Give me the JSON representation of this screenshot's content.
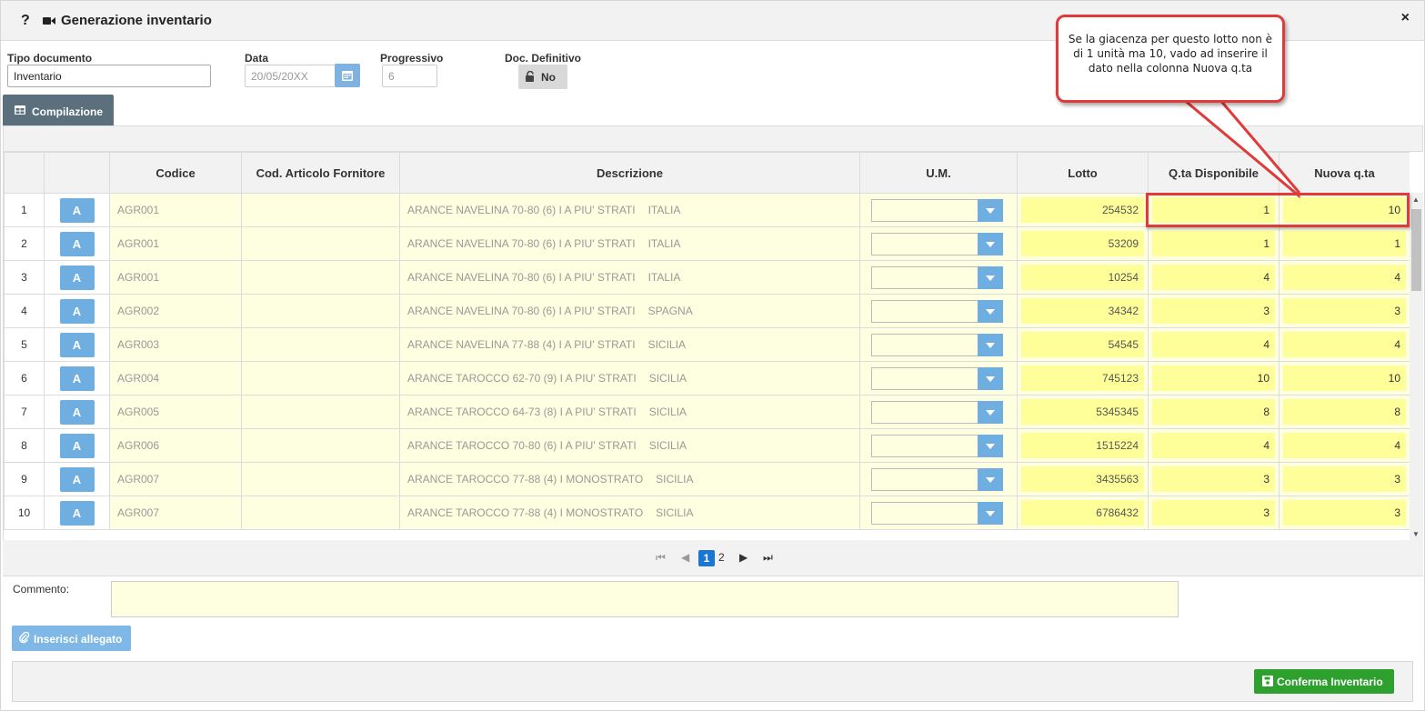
{
  "header": {
    "help_glyph": "?",
    "title": "Generazione inventario",
    "close_glyph": "×"
  },
  "form": {
    "tipo_documento": {
      "label": "Tipo documento",
      "value": "Inventario"
    },
    "data": {
      "label": "Data",
      "value": "20/05/20XX"
    },
    "progressivo": {
      "label": "Progressivo",
      "value": "6"
    },
    "doc_definitivo": {
      "label": "Doc. Definitivo",
      "value": "No"
    }
  },
  "tabs": [
    {
      "label": "Compilazione",
      "active": true
    }
  ],
  "table": {
    "columns": [
      "",
      "",
      "Codice",
      "Cod. Articolo Fornitore",
      "Descrizione",
      "U.M.",
      "Lotto",
      "Q.ta Disponibile",
      "Nuova q.ta"
    ],
    "row_button_label": "A",
    "rows": [
      {
        "n": "1",
        "codice": "AGR001",
        "fornitore": "",
        "descrizione": "ARANCE NAVELINA 70-80 (6) I A PIU' STRATI",
        "origine": "ITALIA",
        "um": "",
        "lotto": "254532",
        "qta": "1",
        "nuova": "10"
      },
      {
        "n": "2",
        "codice": "AGR001",
        "fornitore": "",
        "descrizione": "ARANCE NAVELINA 70-80 (6) I A PIU' STRATI",
        "origine": "ITALIA",
        "um": "",
        "lotto": "53209",
        "qta": "1",
        "nuova": "1"
      },
      {
        "n": "3",
        "codice": "AGR001",
        "fornitore": "",
        "descrizione": "ARANCE NAVELINA 70-80 (6) I A PIU' STRATI",
        "origine": "ITALIA",
        "um": "",
        "lotto": "10254",
        "qta": "4",
        "nuova": "4"
      },
      {
        "n": "4",
        "codice": "AGR002",
        "fornitore": "",
        "descrizione": "ARANCE NAVELINA 70-80 (6) I A PIU' STRATI",
        "origine": "SPAGNA",
        "um": "",
        "lotto": "34342",
        "qta": "3",
        "nuova": "3"
      },
      {
        "n": "5",
        "codice": "AGR003",
        "fornitore": "",
        "descrizione": "ARANCE NAVELINA 77-88 (4) I A PIU' STRATI",
        "origine": "SICILIA",
        "um": "",
        "lotto": "54545",
        "qta": "4",
        "nuova": "4"
      },
      {
        "n": "6",
        "codice": "AGR004",
        "fornitore": "",
        "descrizione": "ARANCE TAROCCO 62-70 (9) I A PIU' STRATI",
        "origine": "SICILIA",
        "um": "",
        "lotto": "745123",
        "qta": "10",
        "nuova": "10"
      },
      {
        "n": "7",
        "codice": "AGR005",
        "fornitore": "",
        "descrizione": "ARANCE TAROCCO 64-73 (8) I A PIU' STRATI",
        "origine": "SICILIA",
        "um": "",
        "lotto": "5345345",
        "qta": "8",
        "nuova": "8"
      },
      {
        "n": "8",
        "codice": "AGR006",
        "fornitore": "",
        "descrizione": "ARANCE TAROCCO 70-80 (6) I A PIU' STRATI",
        "origine": "SICILIA",
        "um": "",
        "lotto": "1515224",
        "qta": "4",
        "nuova": "4"
      },
      {
        "n": "9",
        "codice": "AGR007",
        "fornitore": "",
        "descrizione": "ARANCE TAROCCO 77-88 (4) I MONOSTRATO",
        "origine": "SICILIA",
        "um": "",
        "lotto": "3435563",
        "qta": "3",
        "nuova": "3"
      },
      {
        "n": "10",
        "codice": "AGR007",
        "fornitore": "",
        "descrizione": "ARANCE TAROCCO 77-88 (4) I MONOSTRATO",
        "origine": "SICILIA",
        "um": "",
        "lotto": "6786432",
        "qta": "3",
        "nuova": "3"
      }
    ]
  },
  "pager": {
    "pages": [
      "1",
      "2"
    ],
    "current": "1"
  },
  "comment": {
    "label": "Commento:",
    "value": ""
  },
  "buttons": {
    "attach": "Inserisci allegato",
    "confirm": "Conferma Inventario"
  },
  "annotation": {
    "text": "Se la giacenza per questo lotto non è di 1 unità ma 10, vado ad inserire il dato nella colonna Nuova q.ta"
  },
  "colors": {
    "accent_blue": "#6faee0",
    "tab_dark": "#5b6f7c",
    "yellow_cell": "#ffff99",
    "confirm_green": "#2ea02e",
    "annotation_red": "#e03a3a"
  }
}
